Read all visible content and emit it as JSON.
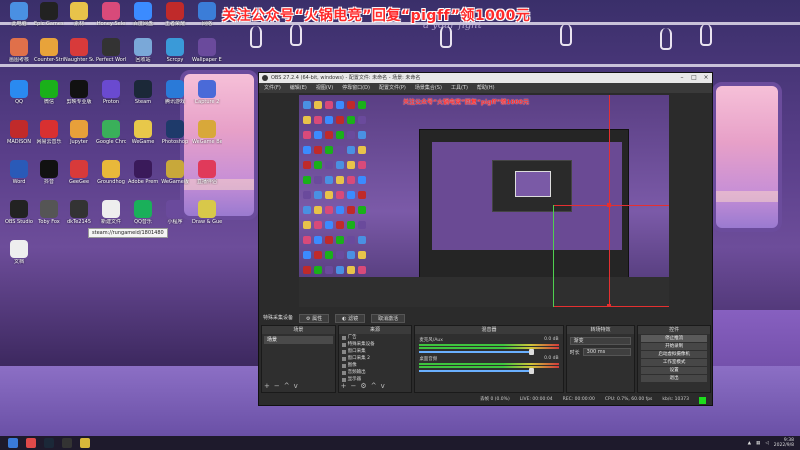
{
  "banner": "关注公众号“火锅电竞”回复“pigff”领1000元",
  "wall_text": "a your fight",
  "desktop_icons": [
    {
      "label": "此电脑",
      "color": "#4a90e2"
    },
    {
      "label": "Epic Games Launcher",
      "color": "#222"
    },
    {
      "label": "素材",
      "color": "#e8c34a"
    },
    {
      "label": "Honey Sele",
      "color": "#d84a7a"
    },
    {
      "label": "百度网盘",
      "color": "#3b8bff"
    },
    {
      "label": "王者荣耀",
      "color": "#c02a2a"
    },
    {
      "label": "网络",
      "color": "#3b7dd8"
    },
    {
      "label": "画图考核",
      "color": "#e0704a"
    },
    {
      "label": "Counter-Strike Global Off",
      "color": "#e8a33a"
    },
    {
      "label": "Naughter Surgeon Party",
      "color": "#d83a3a"
    },
    {
      "label": "Perfect World",
      "color": "#333"
    },
    {
      "label": "回收站",
      "color": "#7aa8d8"
    },
    {
      "label": "Scrcpy",
      "color": "#3a9ad8"
    },
    {
      "label": "Wallpaper Engine",
      "color": "#6a4a9c"
    },
    {
      "label": "QQ",
      "color": "#2a8af0"
    },
    {
      "label": "微信",
      "color": "#1ab01a"
    },
    {
      "label": "剪映专业版",
      "color": "#111"
    },
    {
      "label": "Proton",
      "color": "#6a4ad0"
    },
    {
      "label": "Steam",
      "color": "#1b2838"
    },
    {
      "label": "腾讯游戏",
      "color": "#2a7ad8"
    },
    {
      "label": "Capture 2",
      "color": "#4a6ad8"
    },
    {
      "label": "MADISON",
      "color": "#c02a2a"
    },
    {
      "label": "网易云音乐",
      "color": "#d83030"
    },
    {
      "label": "Jupyter",
      "color": "#e8a03a"
    },
    {
      "label": "Google Chrome",
      "color": "#3ab05a"
    },
    {
      "label": "WeGame",
      "color": "#e8c84a"
    },
    {
      "label": "Photoshop",
      "color": "#1e3a6a"
    },
    {
      "label": "WeGame Beta",
      "color": "#d8a83a"
    },
    {
      "label": "Word",
      "color": "#2a5ab8"
    },
    {
      "label": "抖音",
      "color": "#111"
    },
    {
      "label": "GeeGee",
      "color": "#d83a3a"
    },
    {
      "label": "Groundhog",
      "color": "#e8b83a"
    },
    {
      "label": "Adobe Premiere",
      "color": "#3a1a5a"
    },
    {
      "label": "WeGame版",
      "color": "#c8a83a"
    },
    {
      "label": "直播伴侣",
      "color": "#e03a5a"
    },
    {
      "label": "OBS Studio",
      "color": "#222"
    },
    {
      "label": "Toby Fox",
      "color": "#555"
    },
    {
      "label": "dkTe2145",
      "color": "#333"
    },
    {
      "label": "新建文件",
      "color": "#eee"
    },
    {
      "label": "QQ音乐",
      "color": "#1ab05a"
    },
    {
      "label": "小程序",
      "color": "#6a4a9c"
    },
    {
      "label": "Draw & Guess",
      "color": "#d8c84a"
    },
    {
      "label": "文档",
      "color": "#eee"
    }
  ],
  "tooltip": "steam://rungameid/1801480",
  "obs": {
    "title": "OBS 27.2.4 (64-bit, windows) - 配置文件: 未命名 - 场景: 未命名",
    "menu": [
      "文件(F)",
      "编辑(E)",
      "视图(V)",
      "停靠窗口(D)",
      "配置文件(P)",
      "场景集合(S)",
      "工具(T)",
      "帮助(H)"
    ],
    "preview_banner": "关注公众号“火锅电竞”回复“pigff”领1000元",
    "context_bar": {
      "source": "特殊采集设备",
      "properties": "属性",
      "filters": "滤镜",
      "deactivate": "取消激活"
    },
    "docks": {
      "scenes": {
        "title": "场景",
        "items": [
          "场景"
        ]
      },
      "sources": {
        "title": "来源",
        "items": [
          "广告",
          "特殊采集设备",
          "窗口采集",
          "窗口采集 2",
          "图像",
          "音频输出",
          "显示器"
        ]
      },
      "mixer": {
        "title": "混音器",
        "tracks": [
          {
            "name": "麦克风/Aux",
            "db": "0.0 dB"
          },
          {
            "name": "桌面音频",
            "db": "0.0 dB"
          }
        ]
      },
      "transitions": {
        "title": "转场特效",
        "type": "渐变",
        "duration_label": "时长",
        "duration": "300 ms"
      },
      "controls": {
        "title": "控件",
        "buttons": [
          "停止推流",
          "开始录制",
          "启动虚拟摄像机",
          "工作室模式",
          "设置",
          "退出"
        ]
      }
    },
    "statusbar": {
      "dropped": "丢帧 0 (0.0%)",
      "live": "LIVE: 00:00:04",
      "rec": "REC: 00:00:00",
      "cpu": "CPU: 0.7%, 60.00 fps",
      "kbps": "kb/s: 10373"
    }
  },
  "taskbar": {
    "time": "9:38",
    "date": "2022/9/8"
  }
}
